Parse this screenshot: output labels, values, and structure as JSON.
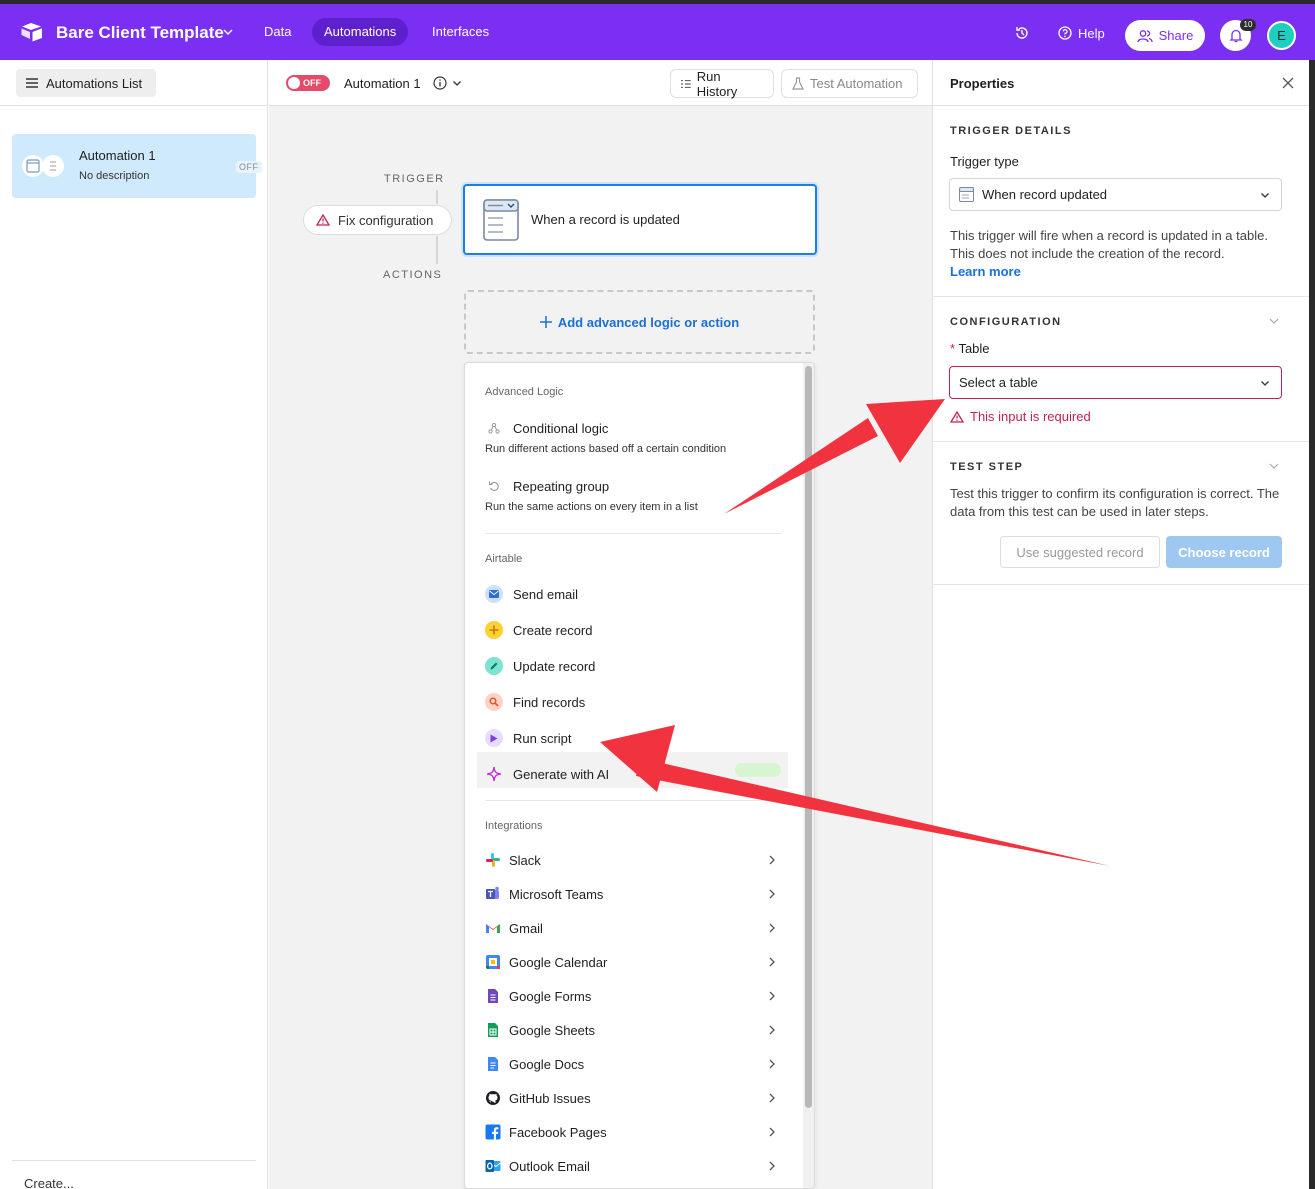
{
  "topbar": {
    "base_name": "Bare Client Template",
    "nav": [
      "Data",
      "Automations",
      "Interfaces"
    ],
    "help": "Help",
    "share": "Share",
    "notifications": "10",
    "avatar_initial": "E",
    "accent_color": "#7b2ff2"
  },
  "sidebar": {
    "list_button": "Automations List",
    "automation": {
      "title": "Automation 1",
      "description": "No description",
      "status": "OFF"
    },
    "create": "Create..."
  },
  "canvas": {
    "toggle": "OFF",
    "name": "Automation 1",
    "run_history": "Run History",
    "test_automation": "Test Automation",
    "trigger_label": "TRIGGER",
    "actions_label": "ACTIONS",
    "fix_config": "Fix configuration",
    "trigger_text": "When a record is updated",
    "add_action": "Add advanced logic or action"
  },
  "menu": {
    "advanced_title": "Advanced Logic",
    "conditional": {
      "label": "Conditional logic",
      "desc": "Run different actions based off a certain condition"
    },
    "repeating": {
      "label": "Repeating group",
      "desc": "Run the same actions on every item in a list"
    },
    "airtable_title": "Airtable",
    "airtable_items": [
      "Send email",
      "Create record",
      "Update record",
      "Find records",
      "Run script",
      "Generate with AI"
    ],
    "integrations_title": "Integrations",
    "integrations": [
      "Slack",
      "Microsoft Teams",
      "Gmail",
      "Google Calendar",
      "Google Forms",
      "Google Sheets",
      "Google Docs",
      "GitHub Issues",
      "Facebook Pages",
      "Outlook Email"
    ]
  },
  "properties": {
    "title": "Properties",
    "trigger_details": "TRIGGER DETAILS",
    "trigger_type_label": "Trigger type",
    "trigger_type_value": "When record updated",
    "trigger_desc": "This trigger will fire when a record is updated in a table. This does not include the creation of the record.",
    "learn_more": "Learn more",
    "configuration": "CONFIGURATION",
    "table_required": "*",
    "table_label": "Table",
    "table_placeholder": "Select a table",
    "table_error": "This input is required",
    "test_step": "TEST STEP",
    "test_desc": "Test this trigger to confirm its configuration is correct. The data from this test can be used in later steps.",
    "use_suggested": "Use suggested record",
    "choose_record": "Choose record"
  },
  "annotation_color": "#f1323f"
}
